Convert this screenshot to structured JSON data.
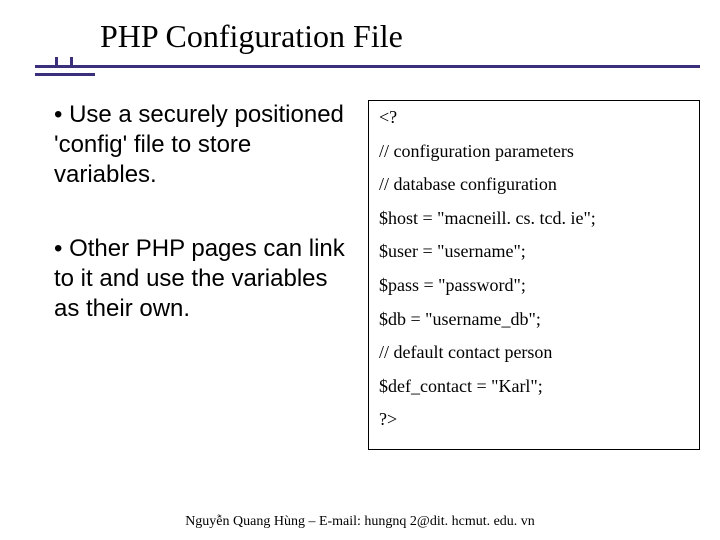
{
  "title": "PHP Configuration File",
  "bullets": [
    "• Use a securely positioned 'config' file to store variables.",
    "• Other PHP pages can link to it and use the variables as their own."
  ],
  "code": {
    "l1": "<?",
    "l2": "// configuration parameters",
    "l3": "// database configuration",
    "l4": "$host = \"macneill. cs. tcd. ie\";",
    "l5": "$user = \"username\";",
    "l6": "$pass = \"password\";",
    "l7": "$db = \"username_db\";",
    "l8": "// default contact person",
    "l9": "$def_contact = \"Karl\";",
    "l10": "?>"
  },
  "footer": "Nguyễn Quang Hùng – E-mail: hungnq 2@dit. hcmut. edu. vn"
}
